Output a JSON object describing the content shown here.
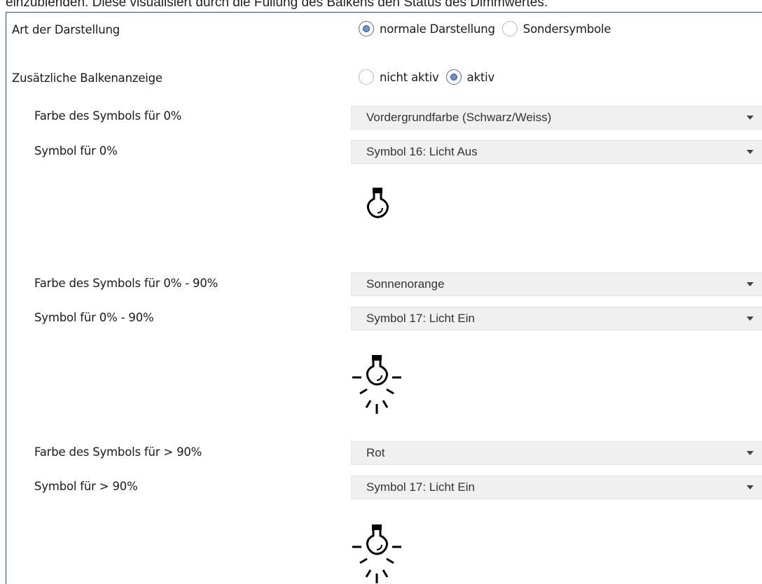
{
  "header_fragment": "einzublenden. Diese visualisiert durch die Füllung des Balkens den Status des Dimmwertes.",
  "rows": {
    "art": {
      "label": "Art der Darstellung",
      "options": [
        {
          "label": "normale Darstellung",
          "checked": true
        },
        {
          "label": "Sondersymbole",
          "checked": false
        }
      ]
    },
    "balken": {
      "label": "Zusätzliche Balkenanzeige",
      "options": [
        {
          "label": "nicht aktiv",
          "checked": false
        },
        {
          "label": "aktiv",
          "checked": true
        }
      ]
    },
    "farbe0": {
      "label": "Farbe des Symbols für 0%",
      "value": "Vordergrundfarbe (Schwarz/Weiss)"
    },
    "symbol0": {
      "label": "Symbol für 0%",
      "value": "Symbol 16: Licht Aus",
      "icon": "light-off-icon"
    },
    "farbe090": {
      "label": "Farbe des Symbols für 0% - 90%",
      "value": "Sonnenorange"
    },
    "symbol090": {
      "label": "Symbol für 0% - 90%",
      "value": "Symbol 17: Licht Ein",
      "icon": "light-on-icon"
    },
    "farbe90": {
      "label": "Farbe des Symbols für > 90%",
      "value": "Rot"
    },
    "symbol90": {
      "label": "Symbol für > 90%",
      "value": "Symbol 17: Licht Ein",
      "icon": "light-on-icon"
    }
  }
}
